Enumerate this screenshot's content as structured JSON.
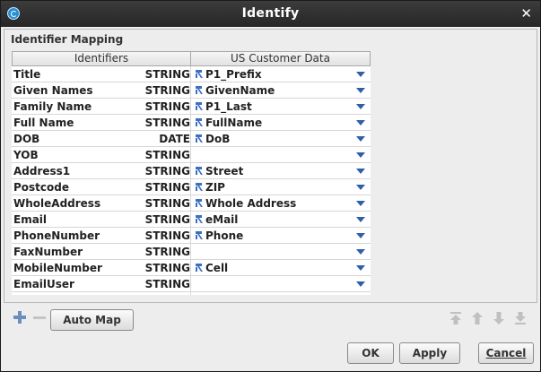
{
  "window": {
    "title": "Identify",
    "close_icon": "close-icon",
    "app_icon": "app-logo-icon"
  },
  "panel": {
    "title": "Identifier Mapping"
  },
  "table": {
    "headers": [
      "Identifiers",
      "US Customer Data"
    ],
    "rows": [
      {
        "name": "Title",
        "type": "STRING",
        "value": "P1_Prefix",
        "mapped": true
      },
      {
        "name": "Given Names",
        "type": "STRING",
        "value": "GivenName",
        "mapped": true
      },
      {
        "name": "Family Name",
        "type": "STRING",
        "value": "P1_Last",
        "mapped": true
      },
      {
        "name": "Full Name",
        "type": "STRING",
        "value": "FullName",
        "mapped": true
      },
      {
        "name": "DOB",
        "type": "DATE",
        "value": "DoB",
        "mapped": true
      },
      {
        "name": "YOB",
        "type": "STRING",
        "value": "",
        "mapped": false
      },
      {
        "name": "Address1",
        "type": "STRING",
        "value": "Street",
        "mapped": true
      },
      {
        "name": "Postcode",
        "type": "STRING",
        "value": "ZIP",
        "mapped": true
      },
      {
        "name": "WholeAddress",
        "type": "STRING",
        "value": "Whole Address",
        "mapped": true
      },
      {
        "name": "Email",
        "type": "STRING",
        "value": "eMail",
        "mapped": true
      },
      {
        "name": "PhoneNumber",
        "type": "STRING",
        "value": "Phone",
        "mapped": true
      },
      {
        "name": "FaxNumber",
        "type": "STRING",
        "value": "",
        "mapped": false
      },
      {
        "name": "MobileNumber",
        "type": "STRING",
        "value": "Cell",
        "mapped": true
      },
      {
        "name": "EmailUser",
        "type": "STRING",
        "value": "",
        "mapped": false
      }
    ]
  },
  "toolbar": {
    "auto_map_label": "Auto Map"
  },
  "buttons": {
    "ok": "OK",
    "apply": "Apply",
    "cancel": "Cancel"
  },
  "colors": {
    "titlebar": "#262626",
    "accent": "#2e5fa8",
    "dialog_bg": "#ededed"
  }
}
